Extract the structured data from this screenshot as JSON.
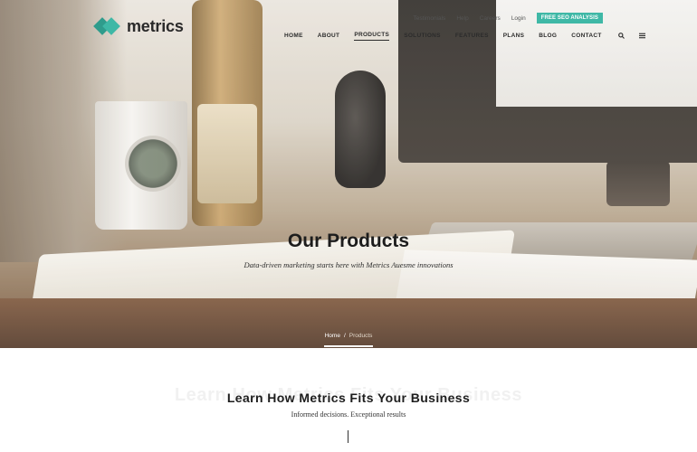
{
  "brand": {
    "name": "metrics",
    "accent": "#3fb8a6"
  },
  "topbar": {
    "links": [
      "Testimonials",
      "Help",
      "Careers",
      "Login"
    ],
    "cta": "FREE SEO ANALYSIS"
  },
  "nav": {
    "items": [
      "HOME",
      "ABOUT",
      "PRODUCTS",
      "SOLUTIONS",
      "FEATURES",
      "PLANS",
      "BLOG",
      "CONTACT"
    ],
    "active": "PRODUCTS",
    "icons": [
      "search-icon",
      "menu-icon"
    ]
  },
  "hero": {
    "title": "Our Products",
    "subtitle": "Data-driven marketing starts here with Metrics Auesme innovations",
    "breadcrumb": {
      "home": "Home",
      "separator": "/",
      "current": "Products"
    }
  },
  "section": {
    "ghost": "Learn How Metrics Fits Your Business",
    "title": "Learn How Metrics Fits Your Business",
    "subtitle": "Informed decisions. Exceptional results"
  }
}
